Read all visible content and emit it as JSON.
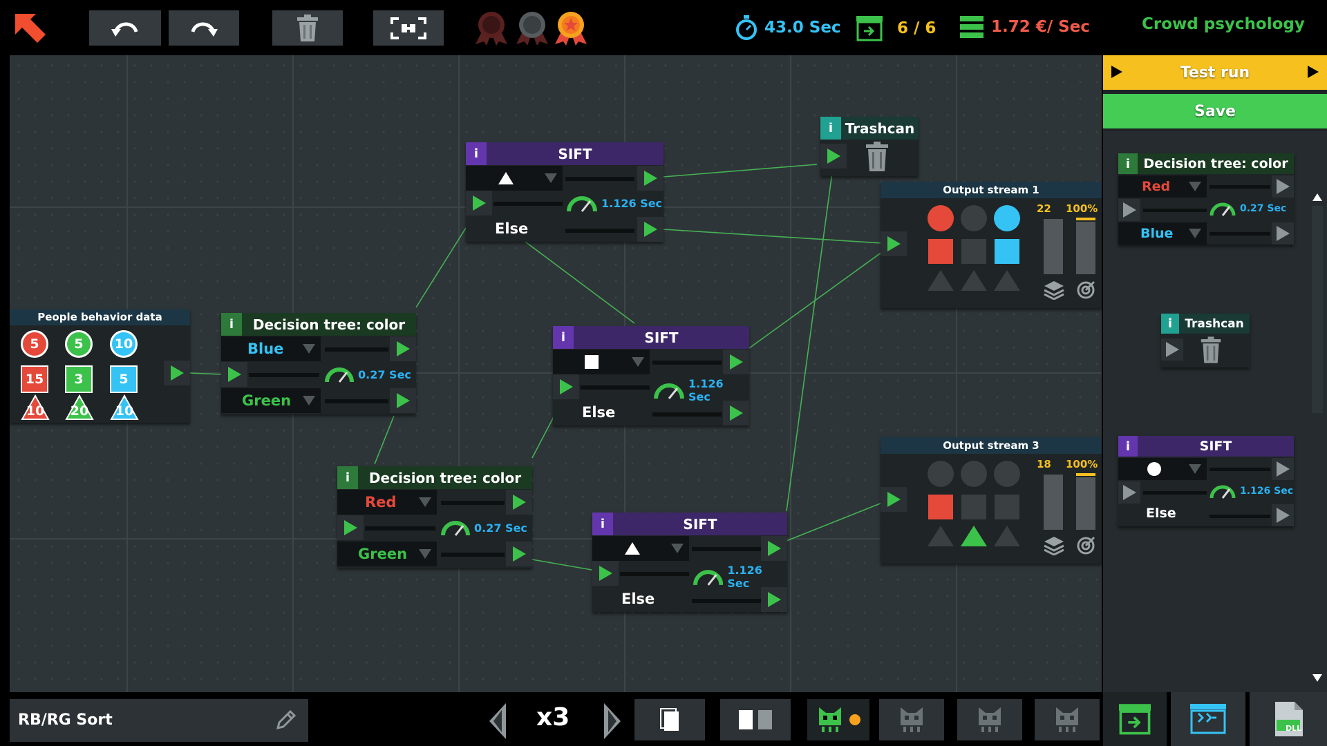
{
  "topbar": {
    "time": "43.0 Sec",
    "outputs": "6 / 6",
    "rate": "1.72 €/ Sec",
    "level_title": "Crowd psychology"
  },
  "actions": {
    "test_run": "Test run",
    "save": "Save"
  },
  "nodes": {
    "people": {
      "title": "People behavior data",
      "values": [
        "5",
        "5",
        "10",
        "15",
        "3",
        "5",
        "10",
        "20",
        "10"
      ]
    },
    "dt_top": {
      "title": "Decision tree: color",
      "opt1": "Blue",
      "opt2": "Green",
      "speed": "0.27 Sec"
    },
    "dt_bottom": {
      "title": "Decision tree: color",
      "opt1": "Red",
      "opt2": "Green",
      "speed": "0.27 Sec"
    },
    "sift_top": {
      "title": "SIFT",
      "speed": "1.126 Sec",
      "else": "Else"
    },
    "sift_mid": {
      "title": "SIFT",
      "speed": "1.126 Sec",
      "else": "Else"
    },
    "sift_bot": {
      "title": "SIFT",
      "speed": "1.126 Sec",
      "else": "Else"
    },
    "trash": {
      "title": "Trashcan"
    },
    "out1": {
      "title": "Output stream 1",
      "count": "22",
      "percent": "100%"
    },
    "out3": {
      "title": "Output stream 3",
      "count": "18",
      "percent": "100%"
    }
  },
  "palette": {
    "dt": {
      "title": "Decision tree: color",
      "opt1": "Red",
      "opt2": "Blue",
      "speed": "0.27 Sec"
    },
    "trash": {
      "title": "Trashcan"
    },
    "sift": {
      "title": "SIFT",
      "speed": "1.126 Sec",
      "else": "Else"
    }
  },
  "bottom": {
    "program_name": "RB/RG Sort",
    "speed": "x3",
    "dll": "DLL"
  },
  "colors": {
    "red": "#e5493a",
    "green": "#3cc24a",
    "blue": "#35c3f5",
    "accent": "#35c4b0",
    "yellow": "#f6c11f",
    "save": "#44cc55"
  }
}
